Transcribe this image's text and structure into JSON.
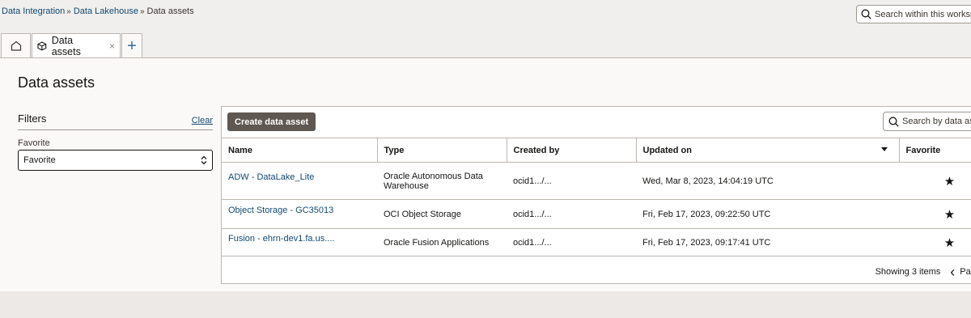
{
  "breadcrumb": {
    "item1": "Data Integration",
    "item2": "Data Lakehouse",
    "current": "Data assets"
  },
  "workspace_search": {
    "placeholder": "Search within this workspace"
  },
  "tabs": {
    "home_icon": "home-icon",
    "active_label": "Data assets",
    "active_icon": "cube-icon",
    "close_glyph": "×",
    "add_glyph": "+"
  },
  "page": {
    "title": "Data assets"
  },
  "filters": {
    "title": "Filters",
    "clear_label": "Clear",
    "favorite_label": "Favorite",
    "favorite_value": "Favorite"
  },
  "toolbar": {
    "create_label": "Create data asset",
    "search_placeholder": "Search by data asset"
  },
  "table": {
    "headers": {
      "name": "Name",
      "type": "Type",
      "created_by": "Created by",
      "updated_on": "Updated on",
      "favorite": "Favorite"
    },
    "rows": [
      {
        "name": "ADW - DataLake_Lite",
        "type": "Oracle Autonomous Data Warehouse",
        "created_by": "ocid1.../...",
        "updated_on": "Wed, Mar 8, 2023, 14:04:19 UTC",
        "favorite": "★"
      },
      {
        "name": "Object Storage - GC35013",
        "type": "OCI Object Storage",
        "created_by": "ocid1.../...",
        "updated_on": "Fri, Feb 17, 2023, 09:22:50 UTC",
        "favorite": "★"
      },
      {
        "name": "Fusion - ehrn-dev1.fa.us....",
        "type": "Oracle Fusion Applications",
        "created_by": "ocid1.../...",
        "updated_on": "Fri, Feb 17, 2023, 09:17:41 UTC",
        "favorite": "★"
      }
    ]
  },
  "pagination": {
    "showing": "Showing 3 items",
    "prev_glyph": "‹",
    "page_label": "Page"
  },
  "colors": {
    "link": "#0f4a75",
    "primary_button": "#5e5752",
    "background": "#f1efed"
  }
}
